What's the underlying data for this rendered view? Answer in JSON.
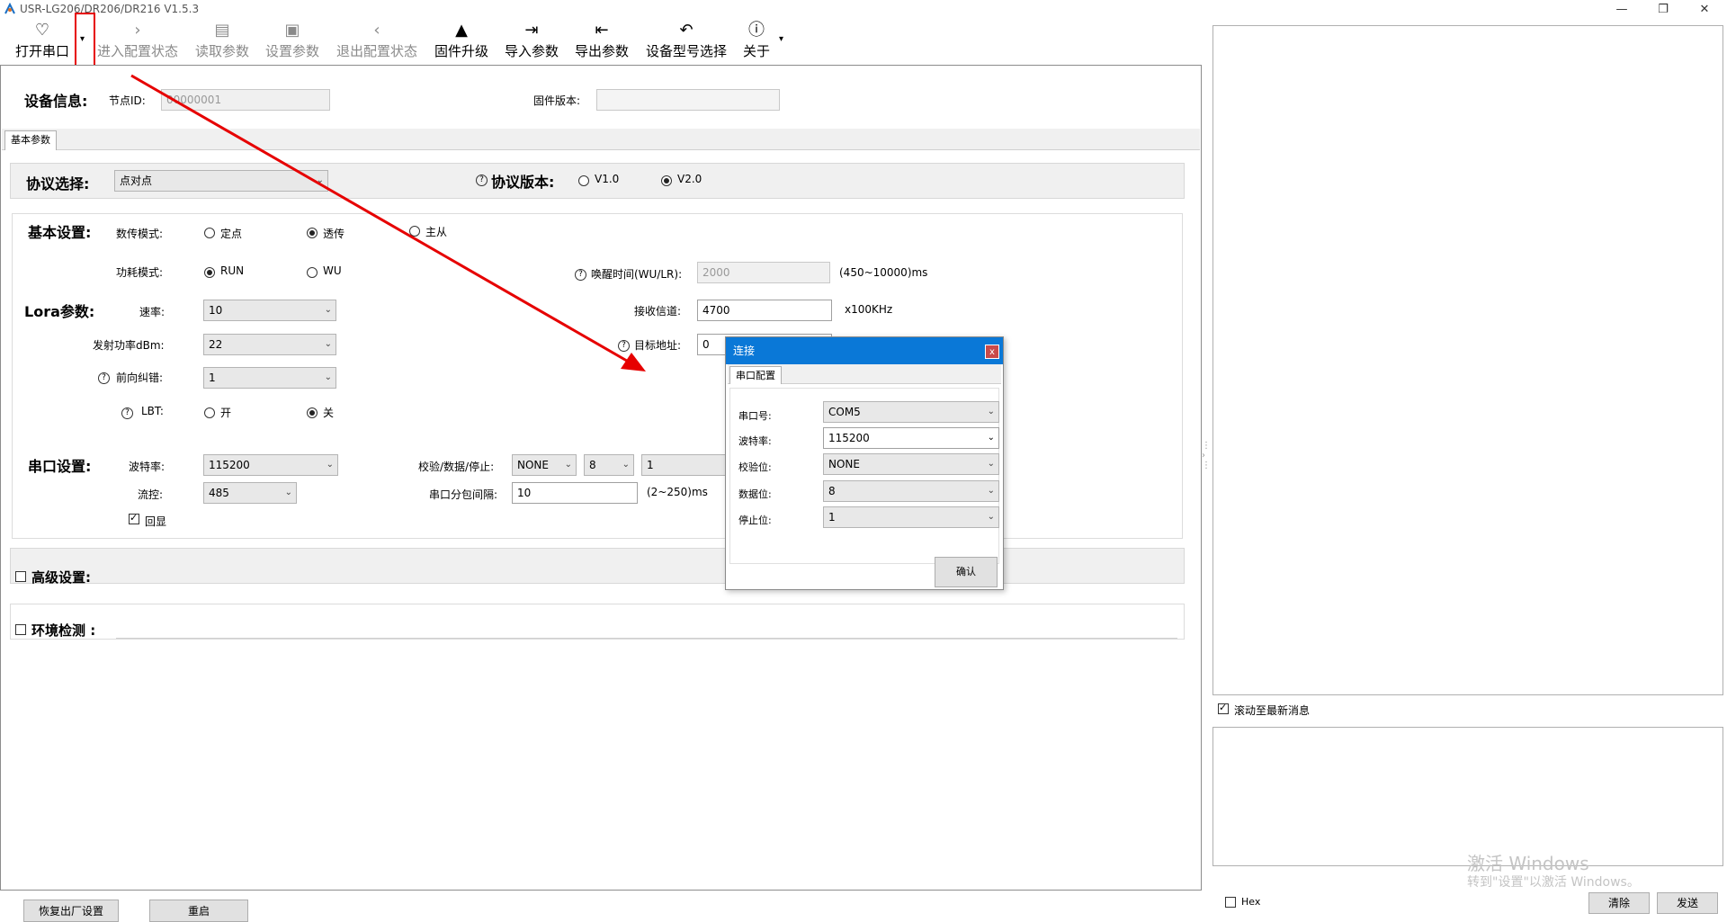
{
  "window": {
    "title": "USR-LG206/DR206/DR216 V1.5.3",
    "minimize": "—",
    "restore": "❐",
    "close": "✕"
  },
  "toolbar": {
    "open_port": "打开串口",
    "enter_config": "进入配置状态",
    "read_params": "读取参数",
    "set_params": "设置参数",
    "exit_config": "退出配置状态",
    "firmware_upgrade": "固件升级",
    "import_params": "导入参数",
    "export_params": "导出参数",
    "device_model": "设备型号选择",
    "about": "关于"
  },
  "device_info": {
    "label": "设备信息:",
    "node_id_label": "节点ID:",
    "node_id_value": "00000001",
    "firmware_label": "固件版本:",
    "firmware_value": ""
  },
  "tabs": {
    "basic": "基本参数"
  },
  "protocol": {
    "label": "协议选择:",
    "value": "点对点",
    "version_label": "协议版本:",
    "v1": "V1.0",
    "v2": "V2.0"
  },
  "basic": {
    "label": "基本设置:",
    "mode_label": "数传模式:",
    "mode_fixed": "定点",
    "mode_transparent": "透传",
    "mode_master": "主从",
    "power_label": "功耗模式:",
    "power_run": "RUN",
    "power_wu": "WU",
    "wake_label": "唤醒时间(WU/LR):",
    "wake_value": "2000",
    "wake_range": "(450~10000)ms"
  },
  "lora": {
    "label": "Lora参数:",
    "rate_label": "速率:",
    "rate_value": "10",
    "power_label": "发射功率dBm:",
    "power_value": "22",
    "fec_label": "前向纠错:",
    "fec_value": "1",
    "lbt_label": "LBT:",
    "lbt_on": "开",
    "lbt_off": "关",
    "channel_label": "接收信道:",
    "channel_value": "4700",
    "channel_unit": "x100KHz",
    "target_label": "目标地址:",
    "target_value": "0"
  },
  "serial": {
    "label": "串口设置:",
    "baud_label": "波特率:",
    "baud_value": "115200",
    "flow_label": "流控:",
    "flow_value": "485",
    "echo_label": "回显",
    "parity_label": "校验/数据/停止:",
    "parity_value": "NONE",
    "data_value": "8",
    "stop_value": "1",
    "interval_label": "串口分包间隔:",
    "interval_value": "10",
    "interval_range": "(2~250)ms"
  },
  "advanced": {
    "label": "高级设置:"
  },
  "env": {
    "label": "环境检测 :"
  },
  "bottom": {
    "factory_reset": "恢复出厂设置",
    "restart": "重启"
  },
  "right": {
    "scroll_latest": "滚动至最新消息",
    "hex": "Hex",
    "clear": "清除",
    "send": "发送"
  },
  "dialog": {
    "title": "连接",
    "close": "x",
    "tab": "串口配置",
    "port_label": "串口号:",
    "port_value": "COM5",
    "baud_label": "波特率:",
    "baud_value": "115200",
    "parity_label": "校验位:",
    "parity_value": "NONE",
    "data_label": "数据位:",
    "data_value": "8",
    "stop_label": "停止位:",
    "stop_value": "1",
    "confirm": "确认"
  },
  "watermark": {
    "line1": "激活 Windows",
    "line2": "转到\"设置\"以激活 Windows。"
  },
  "colors": {
    "accent": "#0a78d7",
    "annotation": "#e60000"
  }
}
